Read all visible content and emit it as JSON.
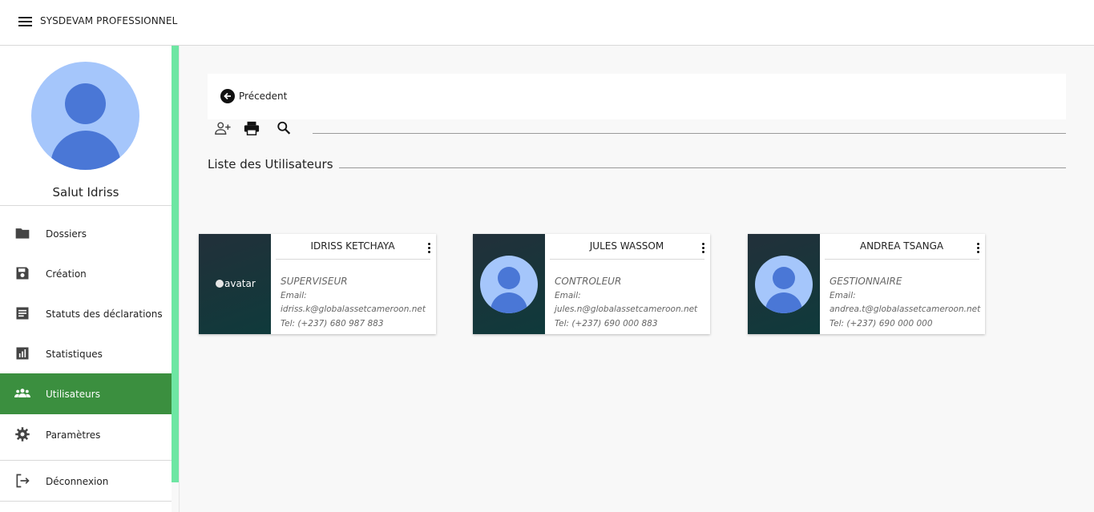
{
  "app": {
    "title": "SYSDEVAM PROFESSIONNEL"
  },
  "sidebar": {
    "greeting": "Salut Idriss",
    "items": [
      {
        "label": "Dossiers",
        "icon": "folder-icon"
      },
      {
        "label": "Création",
        "icon": "save-icon"
      },
      {
        "label": "Statuts des déclarations",
        "icon": "document-icon"
      },
      {
        "label": "Statistiques",
        "icon": "chart-icon"
      },
      {
        "label": "Utilisateurs",
        "icon": "users-icon",
        "active": true
      },
      {
        "label": "Paramètres",
        "icon": "gear-icon"
      },
      {
        "label": "Déconnexion",
        "icon": "logout-icon"
      }
    ]
  },
  "main": {
    "back_label": "Précedent",
    "toolbar": [
      "add-user-icon",
      "print-icon",
      "search-icon"
    ],
    "section_title": "Liste des Utilisateurs"
  },
  "users": [
    {
      "name": "IDRISS KETCHAYA",
      "avatar_alt": "avatar",
      "role": "SUPERVISEUR",
      "email_label": "Email:",
      "email": "idriss.k@globalassetcameroon.net",
      "tel": "Tel: (+237) 680 987 883"
    },
    {
      "name": "JULES WASSOM",
      "role": "CONTROLEUR",
      "email_label": "Email:",
      "email": "jules.n@globalassetcameroon.net",
      "tel": "Tel: (+237) 690 000 883"
    },
    {
      "name": "ANDREA TSANGA",
      "role": "GESTIONNAIRE",
      "email_label": "Email:",
      "email": "andrea.t@globalassetcameroon.net",
      "tel": "Tel: (+237) 690 000 000"
    }
  ],
  "colors": {
    "accent_green": "#6ee6a3",
    "active_nav": "#3b8f3f",
    "avatar_light": "#a5c6fb",
    "avatar_dark": "#4a77d6",
    "card_panel": "#0f3a3b"
  }
}
